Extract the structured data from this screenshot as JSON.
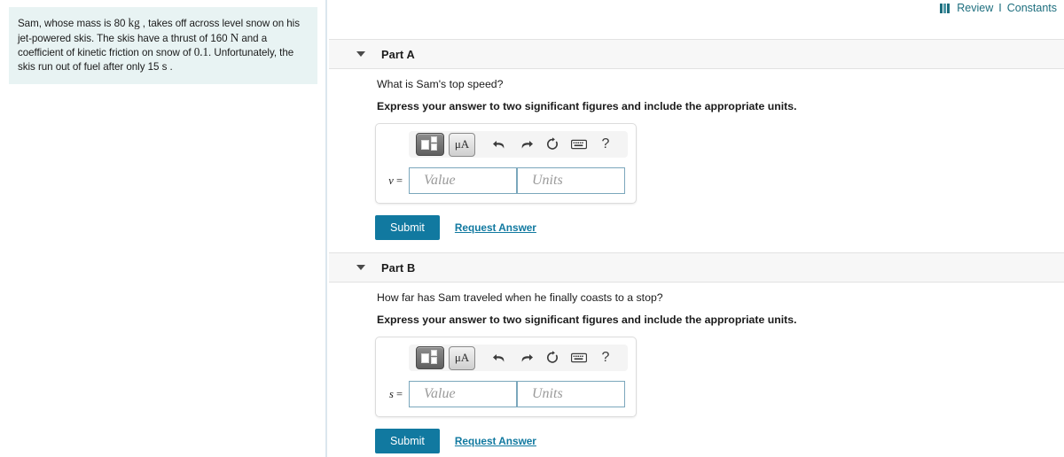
{
  "question": {
    "segments": [
      {
        "t": "Sam, whose mass is 80 ",
        "m": false
      },
      {
        "t": "kg",
        "m": true
      },
      {
        "t": " , takes off across level snow on his jet-powered skis. The skis have a thrust of 160 ",
        "m": false
      },
      {
        "t": "N",
        "m": true
      },
      {
        "t": " and a coefficient of kinetic friction on snow of ",
        "m": false
      },
      {
        "t": "0.1",
        "m": true
      },
      {
        "t": ". Unfortunately, the skis run out of fuel after only 15 s .",
        "m": false
      }
    ],
    "full_text": "Sam, whose mass is 80 kg , takes off across level snow on his jet-powered skis. The skis have a thrust of 160 N and a coefficient of kinetic friction on snow of 0.1. Unfortunately, the skis run out of fuel after only 15 s ."
  },
  "header": {
    "review_label": "Review",
    "separator": "I",
    "constants_label": "Constants",
    "accent_color": "#1d6e7e"
  },
  "toolbar": {
    "template_button_title": "math-template",
    "units_button_label": "μA",
    "undo_title": "undo",
    "redo_title": "redo",
    "reset_title": "reset",
    "keyboard_title": "keyboard",
    "help_label": "?"
  },
  "fields": {
    "value_placeholder": "Value",
    "units_placeholder": "Units",
    "value_current": "",
    "units_current": ""
  },
  "actions": {
    "submit_label": "Submit",
    "request_answer_label": "Request Answer",
    "submit_color": "#1179a0"
  },
  "parts": [
    {
      "title": "Part A",
      "prompt": "What is Sam's top speed?",
      "instruction": "Express your answer to two significant figures and include the appropriate units.",
      "variable": "v",
      "equals": " ="
    },
    {
      "title": "Part B",
      "prompt": "How far has Sam traveled when he finally coasts to a stop?",
      "instruction": "Express your answer to two significant figures and include the appropriate units.",
      "variable": "s",
      "equals": " ="
    }
  ]
}
